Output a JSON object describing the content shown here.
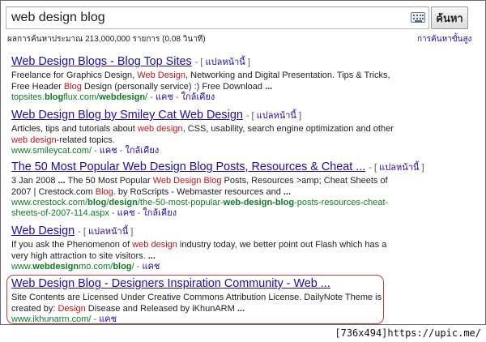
{
  "search": {
    "query": "web design blog",
    "button_label": "ค้นหา",
    "stats": "ผลการค้นหาประมาณ 213,000,000 รายการ (0.08 วินาที)",
    "advanced_link": "การค้นหาขั้นสูง"
  },
  "results": [
    {
      "title_parts": [
        {
          "t": "Web Design"
        },
        {
          "t": " Blogs - "
        },
        {
          "t": "Blog"
        },
        {
          "t": " Top Sites"
        }
      ],
      "translate_prefix": "- [ ",
      "translate_link": "แปลหน้านี้",
      "translate_suffix": " ]",
      "snippet_parts": [
        {
          "t": "Freelance for Graphics Design, "
        },
        {
          "t": "Web Design",
          "hl": true
        },
        {
          "t": ", Networking and Digital Presentation. Tips & Tricks, Free Header "
        },
        {
          "t": "Blog",
          "hl": true
        },
        {
          "t": " Design (personally service) :) Free Download "
        },
        {
          "t": "...",
          "b": true
        }
      ],
      "url_parts": [
        {
          "t": "topsites."
        },
        {
          "t": "blog",
          "b": true
        },
        {
          "t": "flux.com/"
        },
        {
          "t": "webdesign",
          "b": true
        },
        {
          "t": "/"
        }
      ],
      "sep1": " - ",
      "cache": "แคช",
      "sep2": " - ",
      "similar": "ใกล้เคียง"
    },
    {
      "title_parts": [
        {
          "t": "Web Design Blog"
        },
        {
          "t": " by Smiley Cat "
        },
        {
          "t": "Web Design"
        }
      ],
      "translate_prefix": "- [ ",
      "translate_link": "แปลหน้านี้",
      "translate_suffix": " ]",
      "snippet_parts": [
        {
          "t": "Articles, tips and tutorials about "
        },
        {
          "t": "web design",
          "hl": true
        },
        {
          "t": ", CSS, usability, search engine optimization and other "
        },
        {
          "t": "web design",
          "hl": true
        },
        {
          "t": "-related topics."
        }
      ],
      "url_parts": [
        {
          "t": "www.smileycat.com/"
        }
      ],
      "sep1": " - ",
      "cache": "แคช",
      "sep2": " - ",
      "similar": "ใกล้เคียง"
    },
    {
      "title_parts": [
        {
          "t": "The 50 Most Popular "
        },
        {
          "t": "Web Design Blog"
        },
        {
          "t": " Posts, Resources & Cheat "
        },
        {
          "t": "..."
        }
      ],
      "translate_prefix": "- [ ",
      "translate_link": "แปลหน้านี้",
      "translate_suffix": " ]",
      "snippet_parts": [
        {
          "t": "3 Jan 2008 "
        },
        {
          "t": "...",
          "b": true
        },
        {
          "t": " The 50 Most Popular "
        },
        {
          "t": "Web Design Blog",
          "hl": true
        },
        {
          "t": " Posts, Resources >amp; Cheat Sheets of 2007 | Crestock.com "
        },
        {
          "t": "Blog",
          "hl": true
        },
        {
          "t": ". by RoScripts - Webmaster resources and "
        },
        {
          "t": "...",
          "b": true
        }
      ],
      "url_parts": [
        {
          "t": "www.crestock.com/"
        },
        {
          "t": "blog",
          "b": true
        },
        {
          "t": "/"
        },
        {
          "t": "design",
          "b": true
        },
        {
          "t": "/the-50-most-popular-"
        },
        {
          "t": "web-design-blog",
          "b": true
        },
        {
          "t": "-posts-resources-cheat-sheets-of-2007-114.aspx"
        }
      ],
      "sep1": " - ",
      "cache": "แคช",
      "sep2": " - ",
      "similar": "ใกล้เคียง"
    },
    {
      "title_parts": [
        {
          "t": "Web Design"
        }
      ],
      "translate_prefix": "- [ ",
      "translate_link": "แปลหน้านี้",
      "translate_suffix": " ]",
      "snippet_parts": [
        {
          "t": "If you ask the Phenomenon of "
        },
        {
          "t": "web design",
          "hl": true
        },
        {
          "t": " industry today, we better point out Flash which has a very high attraction to site visitors. "
        },
        {
          "t": "...",
          "b": true
        }
      ],
      "url_parts": [
        {
          "t": "www."
        },
        {
          "t": "webdesign",
          "b": true
        },
        {
          "t": "mo.com/"
        },
        {
          "t": "blog",
          "b": true
        },
        {
          "t": "/"
        }
      ],
      "sep1": " - ",
      "cache": "แคช",
      "sep2": "",
      "similar": ""
    },
    {
      "title_parts": [
        {
          "t": "Web Design Blog"
        },
        {
          "t": " - Designers Inspiration Community - Web "
        },
        {
          "t": "..."
        }
      ],
      "translate_prefix": "",
      "translate_link": "",
      "translate_suffix": "",
      "snippet_parts": [
        {
          "t": "Site Contents are Licensed Under Creative Commons Attribution License. DailyNote Theme is created by: "
        },
        {
          "t": "Design",
          "hl": true
        },
        {
          "t": " Disease and Released by iKhunARM "
        },
        {
          "t": "...",
          "b": true
        }
      ],
      "url_parts": [
        {
          "t": "www.ikhunarm.com/"
        }
      ],
      "sep1": " - ",
      "cache": "แคช",
      "sep2": "",
      "similar": ""
    }
  ],
  "footer": {
    "credit": "[736x494]https://upic.me/"
  }
}
